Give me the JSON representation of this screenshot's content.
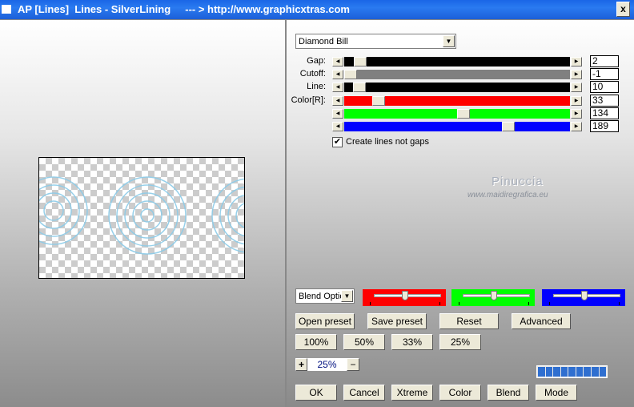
{
  "window": {
    "title": "AP [Lines]  Lines - SilverLining     --- > http://www.graphicxtras.com",
    "close_label": "x"
  },
  "preset_dropdown": {
    "value": "Diamond Bill"
  },
  "sliders": [
    {
      "label": "Gap:",
      "value": "2",
      "position": 0.045,
      "color": "#000000"
    },
    {
      "label": "Cutoff:",
      "value": "-1",
      "position": 0.0,
      "color": "#808080"
    },
    {
      "label": "Line:",
      "value": "10",
      "position": 0.04,
      "color": "#000000"
    },
    {
      "label": "Color[R]:",
      "value": "33",
      "position": 0.13,
      "color": "#ff0000"
    },
    {
      "label": "",
      "value": "134",
      "position": 0.53,
      "color": "#00ff00"
    },
    {
      "label": "",
      "value": "189",
      "position": 0.74,
      "color": "#0000ff"
    }
  ],
  "checkbox": {
    "label": "Create lines not gaps",
    "checked": true
  },
  "watermark": {
    "name": "Pinuccia",
    "url": "www.maidiregrafica.eu"
  },
  "blend_dropdown": {
    "value": "Blend Optio"
  },
  "color_sliders": [
    {
      "color": "#ff0000",
      "position": 0.5
    },
    {
      "color": "#00ff00",
      "position": 0.5
    },
    {
      "color": "#0000ff",
      "position": 0.5
    }
  ],
  "preset_buttons": [
    "Open preset",
    "Save preset",
    "Reset",
    "Advanced"
  ],
  "zoom_buttons": [
    "100%",
    "50%",
    "33%",
    "25%"
  ],
  "zoom": {
    "plus": "+",
    "value": "25%",
    "minus": "−"
  },
  "progress_blocks": 9,
  "bottom_buttons": [
    "OK",
    "Cancel",
    "Xtreme",
    "Color",
    "Blend",
    "Mode"
  ]
}
